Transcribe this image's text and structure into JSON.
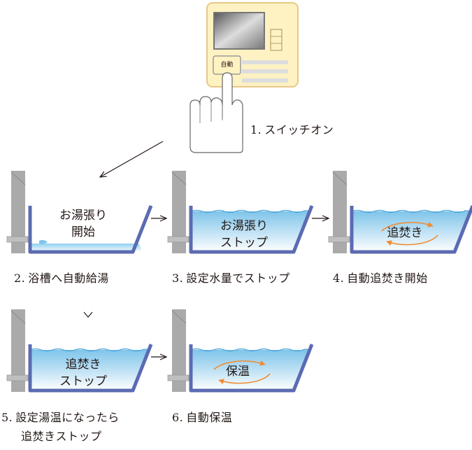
{
  "panel": {
    "button_label": "自動"
  },
  "steps": [
    {
      "number": "1.",
      "label": "スイッチオン"
    },
    {
      "number": "2.",
      "label": "浴槽へ自動給湯",
      "tub_text": [
        "お湯張り",
        "開始"
      ]
    },
    {
      "number": "3.",
      "label": "設定水量でストップ",
      "tub_text": [
        "お湯張り",
        "ストップ"
      ]
    },
    {
      "number": "4.",
      "label": "自動追焚き開始",
      "tub_text": [
        "追焚き"
      ]
    },
    {
      "number": "5.",
      "label": [
        "設定湯温になったら",
        "追焚きストップ"
      ],
      "tub_text": [
        "追焚き",
        "ストップ"
      ]
    },
    {
      "number": "6.",
      "label": "自動保温",
      "tub_text": [
        "保温"
      ]
    }
  ],
  "colors": {
    "tub_outline": "#5b6bb2",
    "water_top": "#7fc4ea",
    "water_bottom": "#ffffff",
    "wall": "#aaaaaa",
    "panel_bg": "#fff2c2",
    "panel_border": "#e8c887",
    "arrow_orange": "#f08c32"
  }
}
